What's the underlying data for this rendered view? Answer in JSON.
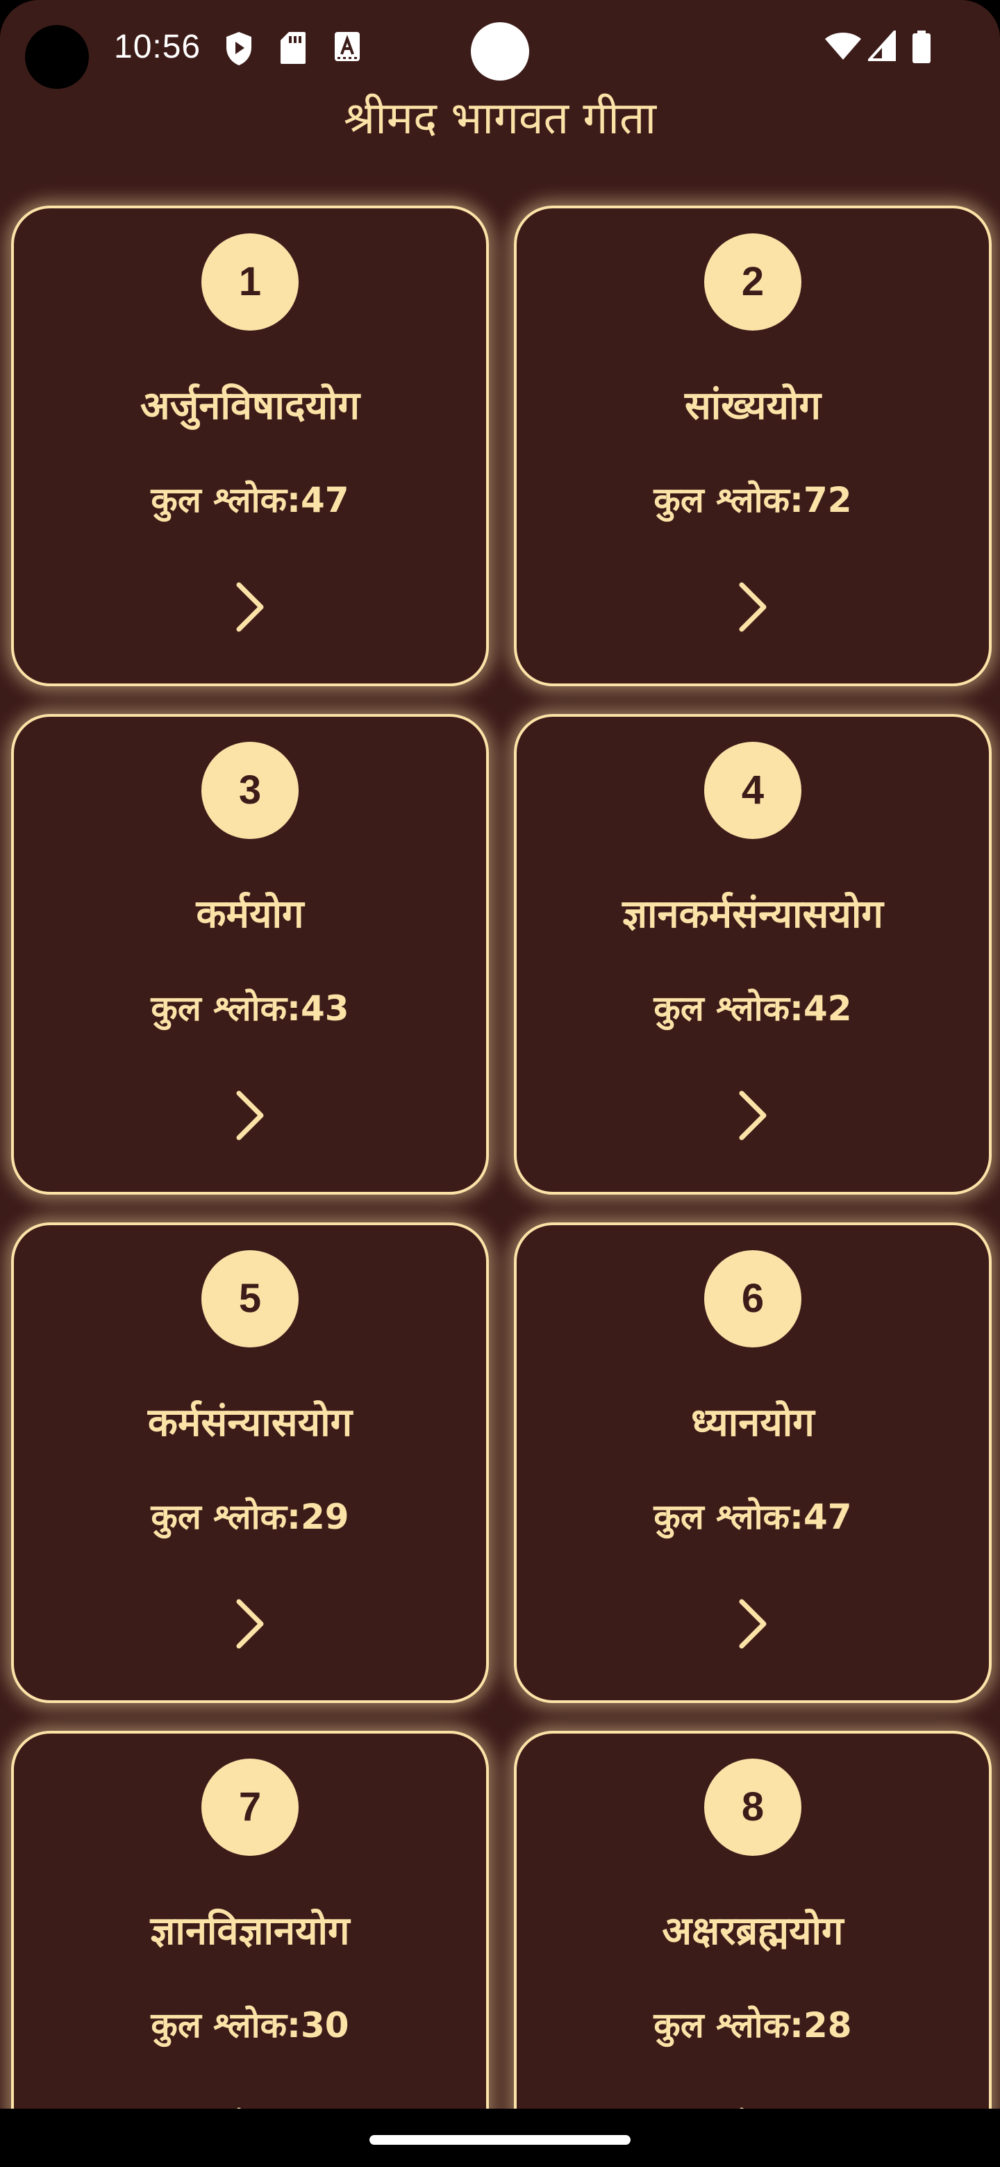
{
  "status_bar": {
    "time": "10:56",
    "left_icons": [
      "shield-play-icon",
      "sd-card-icon",
      "font-a-icon"
    ],
    "right_icons": [
      "wifi-icon",
      "cell-signal-icon",
      "battery-icon"
    ]
  },
  "header": {
    "title": "श्रीमद भागवत गीता"
  },
  "chapters": [
    {
      "number": "1",
      "name": "अर्जुनविषादयोग",
      "verses": "कुल श्लोक:47"
    },
    {
      "number": "2",
      "name": "सांख्ययोग",
      "verses": "कुल श्लोक:72"
    },
    {
      "number": "3",
      "name": "कर्मयोग",
      "verses": "कुल श्लोक:43"
    },
    {
      "number": "4",
      "name": "ज्ञानकर्मसंन्यासयोग",
      "verses": "कुल श्लोक:42"
    },
    {
      "number": "5",
      "name": "कर्मसंन्यासयोग",
      "verses": "कुल श्लोक:29"
    },
    {
      "number": "6",
      "name": "ध्यानयोग",
      "verses": "कुल श्लोक:47"
    },
    {
      "number": "7",
      "name": "ज्ञानविज्ञानयोग",
      "verses": "कुल श्लोक:30"
    },
    {
      "number": "8",
      "name": "अक्षरब्रह्मयोग",
      "verses": "कुल श्लोक:28"
    }
  ],
  "colors": {
    "background": "#3c1c19",
    "accent": "#fbe3a8"
  }
}
